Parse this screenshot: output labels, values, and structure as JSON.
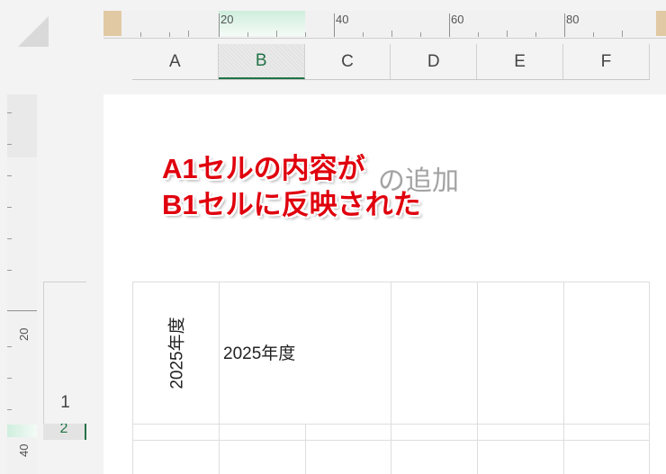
{
  "ruler": {
    "horizontal_labels": [
      "20",
      "40",
      "60",
      "80"
    ],
    "vertical_labels": [
      "20",
      "40"
    ]
  },
  "sheet": {
    "columns": [
      "A",
      "B",
      "C",
      "D",
      "E",
      "F"
    ],
    "selected_column": "B",
    "rows": [
      "1",
      "2"
    ],
    "selected_row": "2"
  },
  "page": {
    "ghost_text": "の追加",
    "annotation": [
      "A1セルの内容が",
      "B1セルに反映された"
    ]
  },
  "cells": {
    "A1": "2025年度",
    "B1": "2025年度"
  },
  "colors": {
    "annotation": "#e0000d",
    "selection": "#217346"
  }
}
